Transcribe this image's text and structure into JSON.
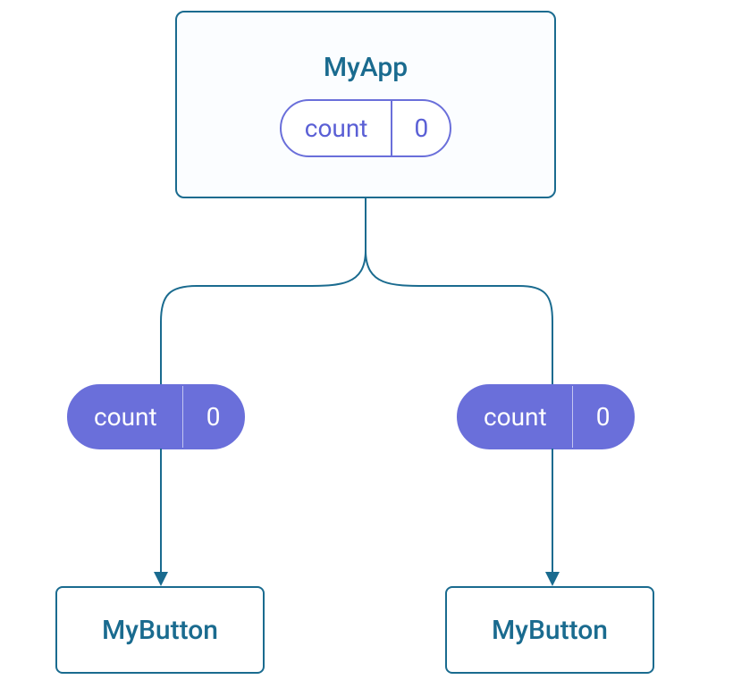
{
  "parent": {
    "title": "MyApp",
    "state": {
      "label": "count",
      "value": "0"
    }
  },
  "passed": {
    "left": {
      "label": "count",
      "value": "0"
    },
    "right": {
      "label": "count",
      "value": "0"
    }
  },
  "children": {
    "left": {
      "title": "MyButton"
    },
    "right": {
      "title": "MyButton"
    }
  },
  "colors": {
    "node_border": "#1a6b8f",
    "accent": "#6a6fda"
  }
}
